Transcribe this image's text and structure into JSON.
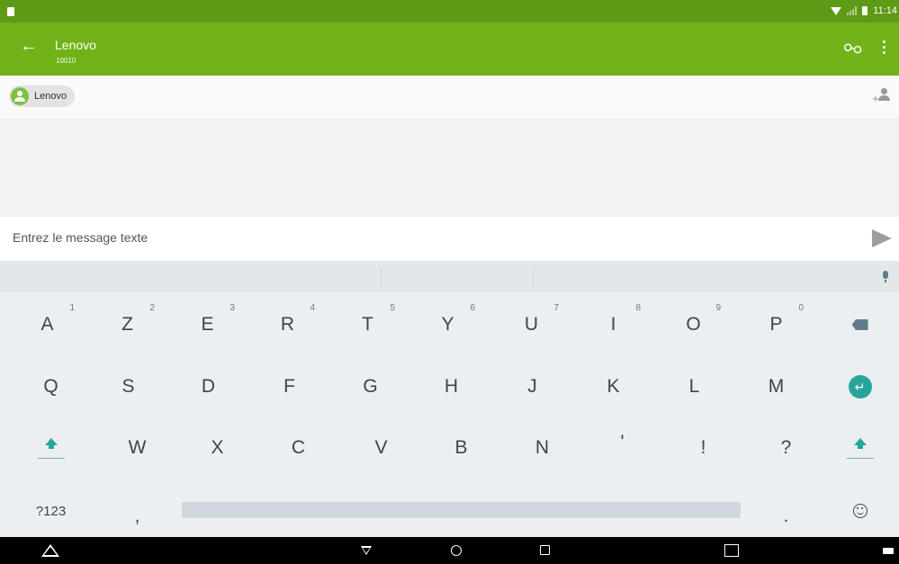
{
  "status_bar": {
    "time": "11:14"
  },
  "app_bar": {
    "title": "Lenovo",
    "subtitle": "10010"
  },
  "recipients": {
    "chip_label": "Lenovo"
  },
  "compose": {
    "placeholder": "Entrez le message texte",
    "value": ""
  },
  "keyboard": {
    "row1": [
      {
        "label": "A",
        "hint": "1"
      },
      {
        "label": "Z",
        "hint": "2"
      },
      {
        "label": "E",
        "hint": "3"
      },
      {
        "label": "R",
        "hint": "4"
      },
      {
        "label": "T",
        "hint": "5"
      },
      {
        "label": "Y",
        "hint": "6"
      },
      {
        "label": "U",
        "hint": "7"
      },
      {
        "label": "I",
        "hint": "8"
      },
      {
        "label": "O",
        "hint": "9"
      },
      {
        "label": "P",
        "hint": "0"
      }
    ],
    "row2": [
      "Q",
      "S",
      "D",
      "F",
      "G",
      "H",
      "J",
      "K",
      "L",
      "M"
    ],
    "row3": [
      "W",
      "X",
      "C",
      "V",
      "B",
      "N",
      "'",
      "!",
      "?"
    ],
    "row4": {
      "symbols_label": "?123",
      "comma": ",",
      "period": "."
    }
  },
  "colors": {
    "app_bar": "#71b218",
    "status_bar": "#5d9a16",
    "accent_teal": "#26a69a"
  },
  "icons": {
    "back": "arrow-left-icon",
    "attach": "paperclip-icon",
    "more": "more-vert-icon",
    "add_contact": "add-person-icon",
    "send": "send-icon",
    "mic": "mic-icon",
    "backspace": "backspace-icon",
    "enter": "enter-icon",
    "shift": "shift-icon",
    "emoji": "emoji-icon"
  }
}
